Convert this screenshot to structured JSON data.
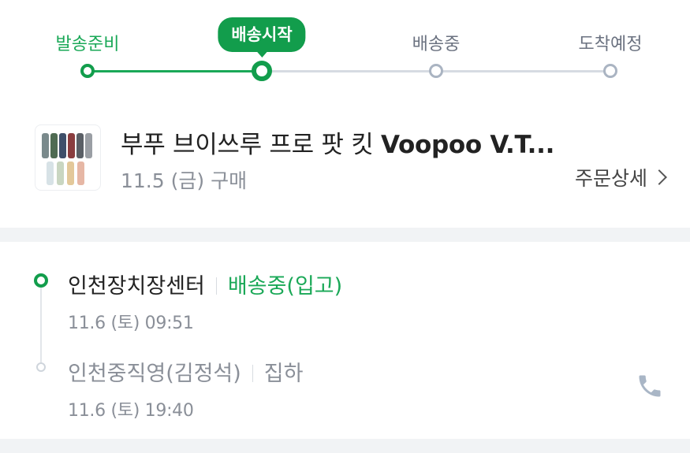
{
  "stepper": {
    "steps": [
      {
        "label": "발송준비",
        "state": "done"
      },
      {
        "label": "배송시작",
        "state": "current"
      },
      {
        "label": "배송중",
        "state": "todo"
      },
      {
        "label": "도착예정",
        "state": "todo"
      }
    ]
  },
  "product": {
    "name_prefix": "부푸 브이쓰루 프로 팟 킷 ",
    "name_bold": "Voopoo V.T...",
    "purchase_date": "11.5 (금) 구매",
    "order_detail_label": "주문상세"
  },
  "tracking": {
    "events": [
      {
        "location": "인천장치장센터",
        "status": "배송중(입고)",
        "time": "11.6 (토) 09:51",
        "active": true
      },
      {
        "location": "인천중직영(김정석)",
        "status": "집하",
        "time": "11.6 (토) 19:40",
        "active": false
      }
    ]
  },
  "icons": {
    "phone": "phone-icon",
    "chevron": "chevron-right-icon"
  },
  "colors": {
    "accent": "#129d4c",
    "accent_text": "#1aa857",
    "inactive": "#aab4c2",
    "muted_text": "#8a8f98",
    "band": "#f1f3f5"
  }
}
